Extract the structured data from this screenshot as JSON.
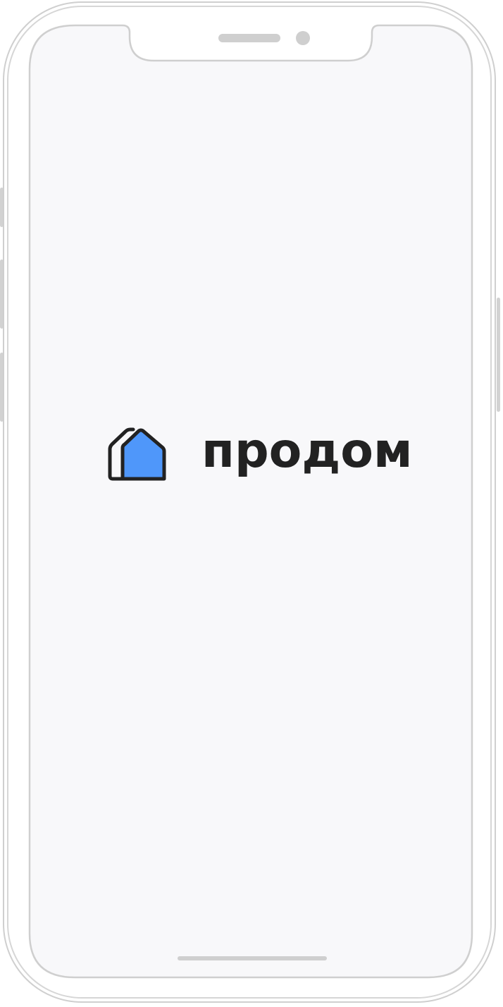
{
  "app": {
    "brand_name": "продом",
    "logo_icon": "house-logo-icon",
    "colors": {
      "background": "#f8f8fa",
      "brand_blue": "#4f97fa",
      "text": "#222222",
      "frame": "#cfcfcf"
    }
  },
  "device": {
    "speaker_icon": "speaker-grille",
    "camera_icon": "front-camera-dot"
  }
}
